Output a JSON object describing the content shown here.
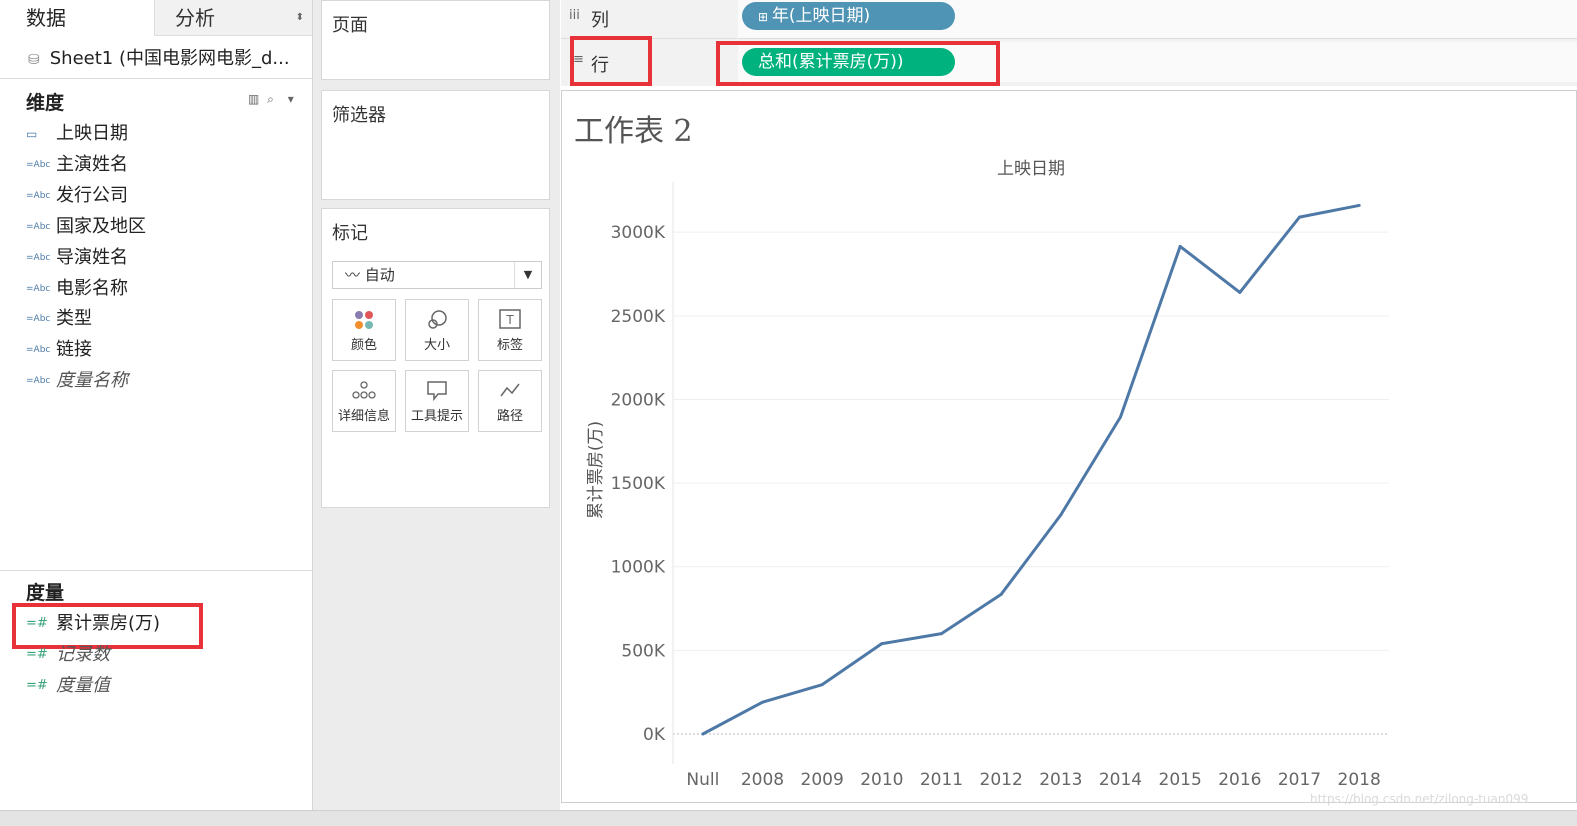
{
  "tabs": {
    "data": "数据",
    "analysis": "分析"
  },
  "data_source": "Sheet1 (中国电影网电影_d...",
  "dimensions": {
    "title": "维度",
    "items": [
      {
        "label": "上映日期",
        "type": "date"
      },
      {
        "label": "主演姓名",
        "type": "Abc"
      },
      {
        "label": "发行公司",
        "type": "Abc"
      },
      {
        "label": "国家及地区",
        "type": "Abc"
      },
      {
        "label": "导演姓名",
        "type": "Abc"
      },
      {
        "label": "电影名称",
        "type": "Abc"
      },
      {
        "label": "类型",
        "type": "Abc"
      },
      {
        "label": "链接",
        "type": "Abc"
      },
      {
        "label": "度量名称",
        "type": "Abc"
      }
    ]
  },
  "measures": {
    "title": "度量",
    "items": [
      {
        "label": "累计票房(万)",
        "type": "#"
      },
      {
        "label": "记录数",
        "type": "#"
      },
      {
        "label": "度量值",
        "type": "#"
      }
    ]
  },
  "cards": {
    "pages": "页面",
    "filters": "筛选器",
    "marks": "标记",
    "mark_type": "自动",
    "mark_buttons": [
      "颜色",
      "大小",
      "标签",
      "详细信息",
      "工具提示",
      "路径"
    ]
  },
  "shelves": {
    "columns_label": "列",
    "rows_label": "行",
    "columns_pill": "年(上映日期)",
    "rows_pill": "总和(累计票房(万))",
    "columns_pill_color": "#4f94b4",
    "rows_pill_color": "#00b27d"
  },
  "sheet_title": "工作表 2",
  "watermark": "https://blog.csdn.net/zilong-tuan099",
  "chart_data": {
    "type": "line",
    "title": "上映日期",
    "xlabel": "",
    "ylabel": "累计票房(万)",
    "categories": [
      "Null",
      "2008",
      "2009",
      "2010",
      "2011",
      "2012",
      "2013",
      "2014",
      "2015",
      "2016",
      "2017",
      "2018"
    ],
    "values": [
      0,
      190000,
      295000,
      540000,
      600000,
      835000,
      1310000,
      1895000,
      2915000,
      2640000,
      3090000,
      3160000
    ],
    "yticks": [
      "0K",
      "500K",
      "1000K",
      "1500K",
      "2000K",
      "2500K",
      "3000K"
    ],
    "ylim": [
      0,
      3300000
    ],
    "line_color": "#4e79a7",
    "grid": true
  }
}
